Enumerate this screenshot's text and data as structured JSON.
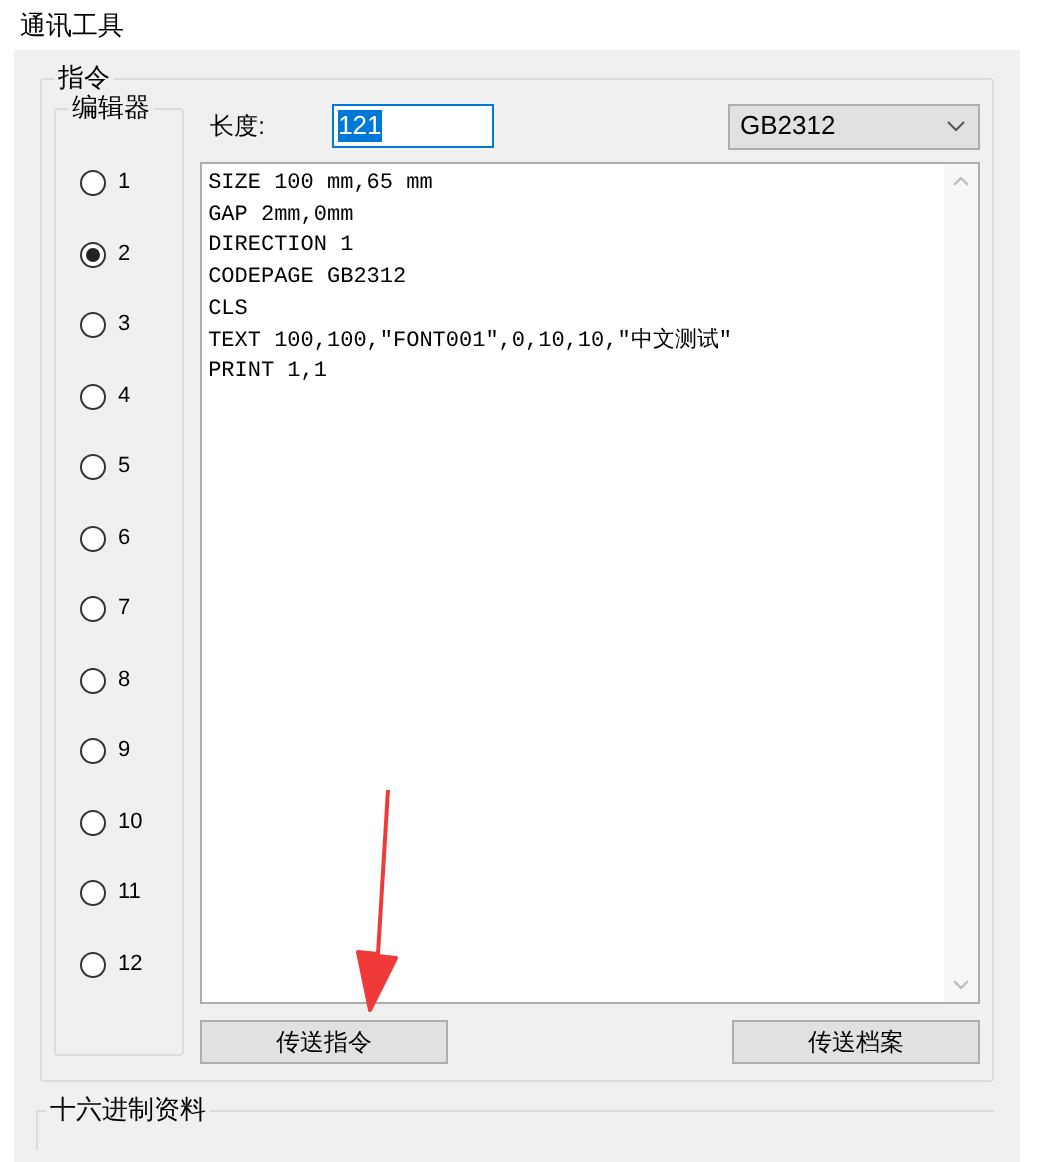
{
  "window": {
    "title": "通讯工具"
  },
  "command_group": {
    "title": "指令",
    "editor_group": {
      "title": "编辑器",
      "options": [
        {
          "label": "1",
          "selected": false
        },
        {
          "label": "2",
          "selected": true
        },
        {
          "label": "3",
          "selected": false
        },
        {
          "label": "4",
          "selected": false
        },
        {
          "label": "5",
          "selected": false
        },
        {
          "label": "6",
          "selected": false
        },
        {
          "label": "7",
          "selected": false
        },
        {
          "label": "8",
          "selected": false
        },
        {
          "label": "9",
          "selected": false
        },
        {
          "label": "10",
          "selected": false
        },
        {
          "label": "11",
          "selected": false
        },
        {
          "label": "12",
          "selected": false
        }
      ]
    },
    "length": {
      "label": "长度:",
      "value": "121"
    },
    "encoding": {
      "value": "GB2312"
    },
    "editor_lines": [
      "SIZE 100 mm,65 mm",
      "GAP 2mm,0mm",
      "DIRECTION 1",
      "CODEPAGE GB2312",
      "CLS",
      "TEXT 100,100,\"FONT001\",0,10,10,\"中文测试\"",
      "PRINT 1,1"
    ],
    "buttons": [
      "传送指令",
      "传送档案"
    ]
  },
  "hex_group": {
    "title": "十六进制资料"
  }
}
